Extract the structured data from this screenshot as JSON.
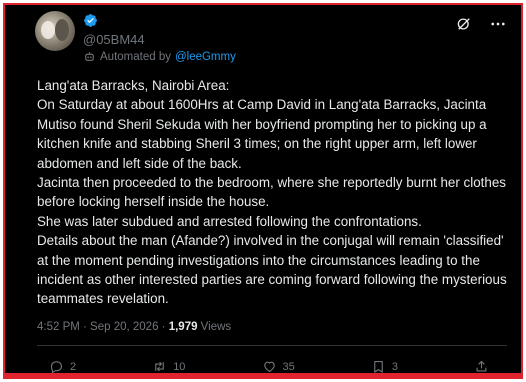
{
  "author": {
    "handle": "@05BM44",
    "verified_color": "#1d9bf0",
    "automated_prefix": "Automated by",
    "automated_link": "@leeGmmy"
  },
  "top_icons": [
    "grok-icon",
    "more-icon"
  ],
  "post": {
    "paragraphs": [
      "Lang'ata Barracks, Nairobi Area:",
      "On Saturday at about 1600Hrs at Camp David in Lang'ata Barracks, Jacinta Mutiso found Sheril Sekuda with her boyfriend prompting her to picking up a kitchen knife and stabbing Sheril 3 times; on the right upper arm, left lower abdomen and left side of the back.",
      "Jacinta then proceeded to the bedroom, where she reportedly burnt her clothes before locking herself inside the house.",
      "She was later subdued and arrested following the confrontations.",
      "Details about the man (Afande?) involved in the conjugal will remain 'classified' at the moment pending investigations into the circumstances leading to the incident as other interested parties are coming forward following the mysterious teammates revelation."
    ],
    "timestamp": "4:52 PM · Sep 20, 2026 · ",
    "views_count": "1,979",
    "views_label": " Views"
  },
  "actions": {
    "replies": "2",
    "reposts": "10",
    "likes": "35",
    "bookmarks": "3"
  },
  "colors": {
    "background": "#000000",
    "text": "#e7e9ea",
    "muted": "#71767b",
    "accent": "#1d9bf0",
    "border_highlight": "#e0242f"
  }
}
